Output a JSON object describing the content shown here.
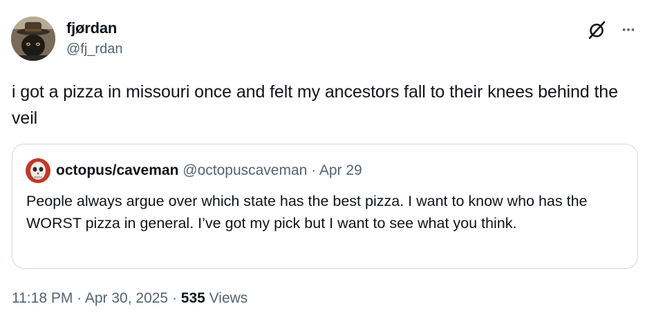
{
  "author": {
    "display_name": "fjørdan",
    "handle": "@fj_rdan"
  },
  "tweet": {
    "text": "i got a pizza in missouri once and felt my ancestors fall to their knees behind the veil"
  },
  "quoted_tweet": {
    "display_name": "octopus/caveman",
    "handle": "@octopuscaveman",
    "separator": " · ",
    "date": "Apr 29",
    "text": "People always argue over which state has the best pizza. I want to know who has the WORST pizza in general. I’ve got my pick but I want to see what you think."
  },
  "footer": {
    "time": "11:18 PM",
    "separator": " · ",
    "date": "Apr 30, 2025",
    "views_count": "535",
    "views_label": " Views"
  },
  "icons": {
    "grok": "grok-icon",
    "more": "more-options-icon"
  },
  "colors": {
    "text_primary": "#0f1419",
    "text_secondary": "#536471",
    "border": "#cfd9de"
  }
}
